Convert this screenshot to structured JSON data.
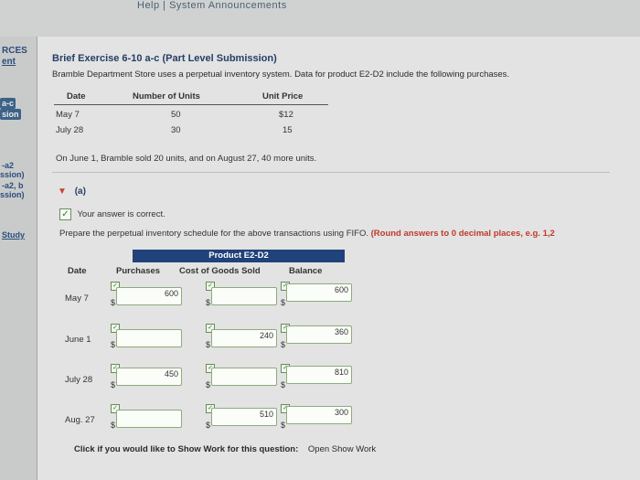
{
  "topbar": {
    "links": "Help | System Announcements"
  },
  "leftnav": {
    "resources_label": "RCES",
    "resources_sub": "ent",
    "q1_tag": "a-c",
    "q1_tag2": "sion",
    "q2_a": "-a2",
    "q2_b": "ssion)",
    "q3_a": "-a2, b",
    "q3_b": "ssion)",
    "study": "Study"
  },
  "exercise": {
    "title": "Brief Exercise 6-10 a-c (Part Level Submission)",
    "description": "Bramble Department Store uses a perpetual inventory system. Data for product E2-D2 include the following purchases.",
    "purchases": {
      "headers": [
        "Date",
        "Number of Units",
        "Unit Price"
      ],
      "rows": [
        {
          "date": "May 7",
          "units": "50",
          "price": "$12"
        },
        {
          "date": "July 28",
          "units": "30",
          "price": "15"
        }
      ]
    },
    "sales_note": "On June 1, Bramble sold 20 units, and on August 27, 40 more units."
  },
  "part": {
    "label": "(a)",
    "status": "Your answer is correct.",
    "instruction": "Prepare the perpetual inventory schedule for the above transactions using FIFO.",
    "instruction_hint": "(Round answers to 0 decimal places, e.g. 1,2"
  },
  "schedule": {
    "title": "Product E2-D2",
    "columns": [
      "Date",
      "Purchases",
      "Cost of Goods Sold",
      "Balance"
    ],
    "currency": "$",
    "rows": [
      {
        "date": "May 7",
        "purchases": "600",
        "cogs": "",
        "balance": "600"
      },
      {
        "date": "June 1",
        "purchases": "",
        "cogs": "240",
        "balance": "360"
      },
      {
        "date": "July 28",
        "purchases": "450",
        "cogs": "",
        "balance": "810"
      },
      {
        "date": "Aug. 27",
        "purchases": "",
        "cogs": "510",
        "balance": "300"
      }
    ]
  },
  "show_work": {
    "prompt": "Click if you would like to Show Work for this question:",
    "link": "Open Show Work"
  }
}
